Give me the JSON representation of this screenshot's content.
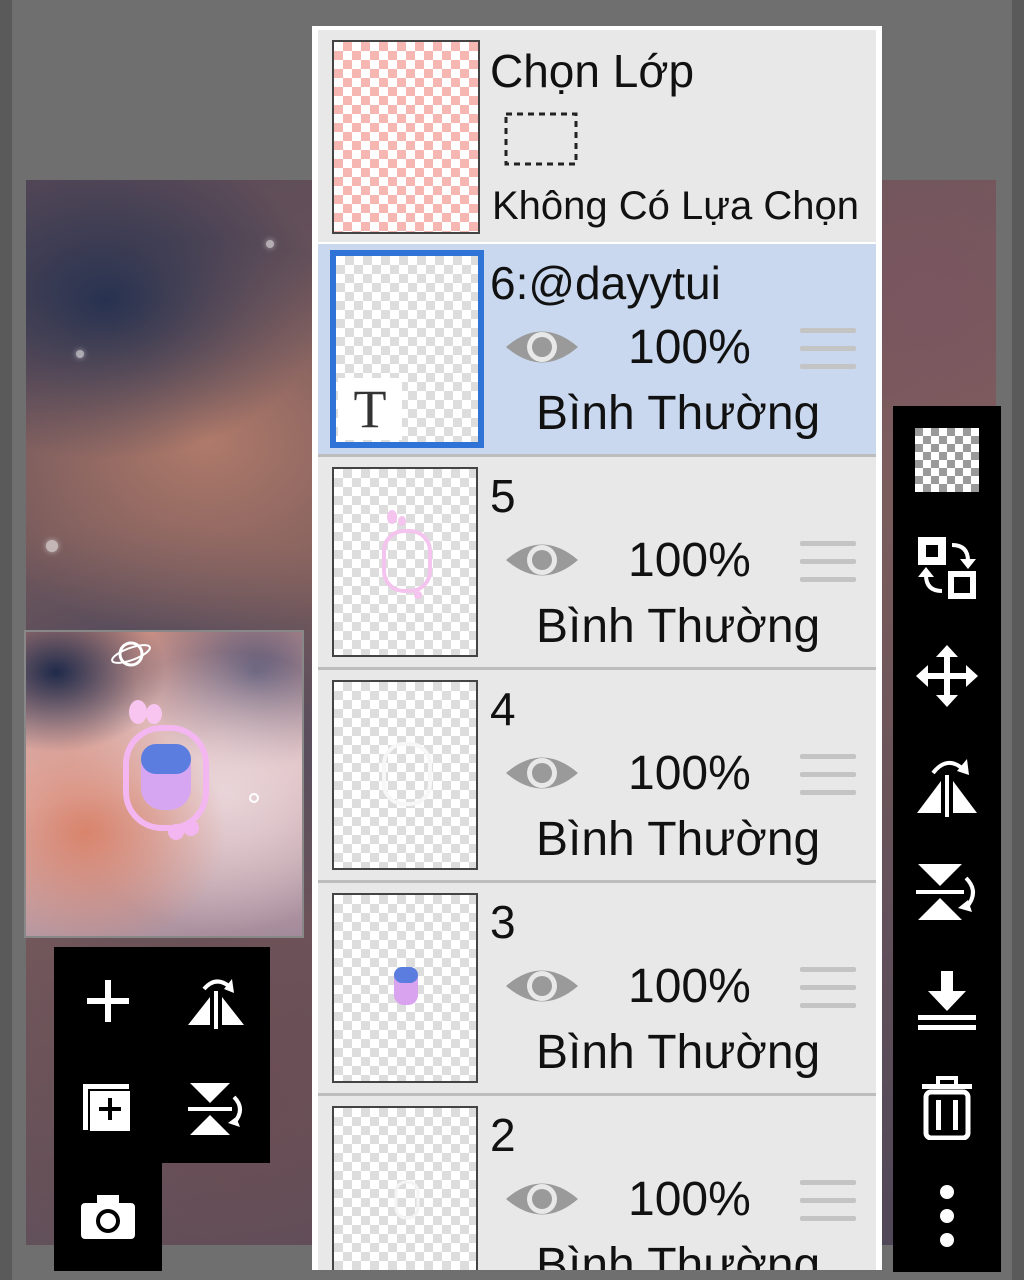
{
  "selection": {
    "title": "Chọn Lớp",
    "status": "Không Có Lựa Chọn"
  },
  "layers": [
    {
      "name": "6:@dayytui",
      "opacity": "100%",
      "blend": "Bình Thường",
      "active": true,
      "type": "text",
      "type_glyph": "T"
    },
    {
      "name": "5",
      "opacity": "100%",
      "blend": "Bình Thường",
      "active": false
    },
    {
      "name": "4",
      "opacity": "100%",
      "blend": "Bình Thường",
      "active": false
    },
    {
      "name": "3",
      "opacity": "100%",
      "blend": "Bình Thường",
      "active": false
    },
    {
      "name": "2",
      "opacity": "100%",
      "blend": "Bình Thường",
      "active": false
    }
  ],
  "left_tools": [
    "add-layer-icon",
    "flip-horizontal-icon",
    "add-copy-layer-icon",
    "flip-vertical-icon",
    "camera-icon"
  ],
  "right_tools": [
    "transparency-icon",
    "swap-layer-icon",
    "move-icon",
    "flip-horizontal-icon",
    "flip-vertical-icon",
    "merge-down-icon",
    "trash-icon",
    "more-vert-icon"
  ],
  "colors": {
    "active_layer_bg": "#c9d8ee",
    "active_border": "#2f73d6",
    "toolbar_bg": "#000000"
  }
}
